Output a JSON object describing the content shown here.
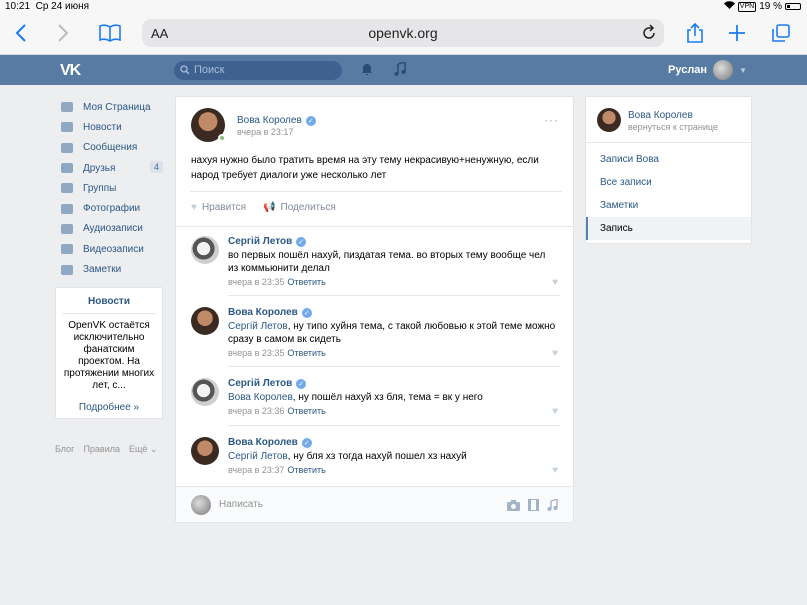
{
  "statusbar": {
    "time": "10:21",
    "date": "Ср 24 июня",
    "vpn": "VPN",
    "battery": "19 %"
  },
  "browser": {
    "text_size": "AA",
    "url": "openvk.org"
  },
  "header": {
    "logo": "VK",
    "search_placeholder": "Поиск",
    "user_name": "Руслан"
  },
  "menu": [
    {
      "label": "Моя Страница"
    },
    {
      "label": "Новости"
    },
    {
      "label": "Сообщения"
    },
    {
      "label": "Друзья",
      "badge": "4"
    },
    {
      "label": "Группы"
    },
    {
      "label": "Фотографии"
    },
    {
      "label": "Аудиозаписи"
    },
    {
      "label": "Видеозаписи"
    },
    {
      "label": "Заметки"
    }
  ],
  "news": {
    "title": "Новости",
    "text": "OpenVK остаётся исключительно фанатским проектом. На протяжении многих лет, с...",
    "more": "Подробнее »"
  },
  "footer": {
    "blog": "Блог",
    "rules": "Правила",
    "more": "Ещё"
  },
  "post": {
    "author": "Вова Королев",
    "time": "вчера в 23:17",
    "text": "нахуя нужно было тратить время на эту тему некрасивую+ненужную, если народ требует диалоги уже несколько лет",
    "like": "Нравится",
    "share": "Поделиться"
  },
  "comments": [
    {
      "author": "Сергій Летов",
      "mention": "",
      "text": "во первых пошёл нахуй, пиздатая тема. во вторых тему вообще чел из коммьюнити делал",
      "time": "вчера в 23:35",
      "reply": "Ответить"
    },
    {
      "author": "Вова Королев",
      "mention": "Сергій Летов",
      "text": ", ну типо хуйня тема, с такой любовью к этой теме можно сразу в самом вк сидеть",
      "time": "вчера в 23:35",
      "reply": "Ответить"
    },
    {
      "author": "Сергій Летов",
      "mention": "Вова Королев",
      "text": ", ну пошёл нахуй хз бля, тема = вк у него",
      "time": "вчера в 23:36",
      "reply": "Ответить"
    },
    {
      "author": "Вова Королев",
      "mention": "Сергій Летов",
      "text": ", ну бля хз тогда нахуй пошел хз нахуй",
      "time": "вчера в 23:37",
      "reply": "Ответить"
    }
  ],
  "composer": {
    "placeholder": "Написать"
  },
  "sidebar": {
    "name": "Вова Королев",
    "back": "вернуться к странице",
    "links": [
      "Записи Вова",
      "Все записи",
      "Заметки",
      "Запись"
    ]
  }
}
